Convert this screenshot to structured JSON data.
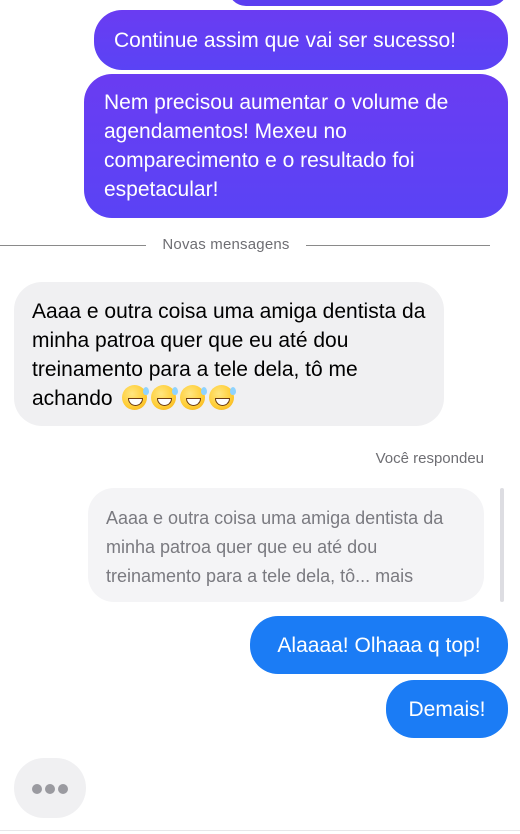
{
  "messages": {
    "sent_1": "Continue assim que vai ser sucesso!",
    "sent_2": "Nem precisou aumentar o volume de agendamentos! Mexeu no comparecimento e o resultado foi espetacular!",
    "new_messages_divider": "Novas mensagens",
    "received_1_text": "Aaaa e outra coisa uma amiga dentista da minha patroa quer que eu até dou treinamento para a tele dela, tô me achando",
    "received_1_emoji": [
      "grinning-sweat-emoji",
      "grinning-sweat-emoji",
      "grinning-sweat-emoji",
      "grinning-sweat-emoji"
    ],
    "you_replied_label": "Você respondeu",
    "reply_quote": "Aaaa e outra coisa uma amiga dentista da minha patroa quer que eu até dou treinamento para a tele dela, tô... mais",
    "sent_3": "Alaaaa! Olhaaa q top!",
    "sent_4": "Demais!"
  },
  "typing_indicator": {
    "icon": "typing-dots-icon"
  },
  "colors": {
    "sent_purple": "#5b3ef0",
    "sent_blue": "#1b7cf5",
    "received_gray": "#f0f0f2"
  }
}
